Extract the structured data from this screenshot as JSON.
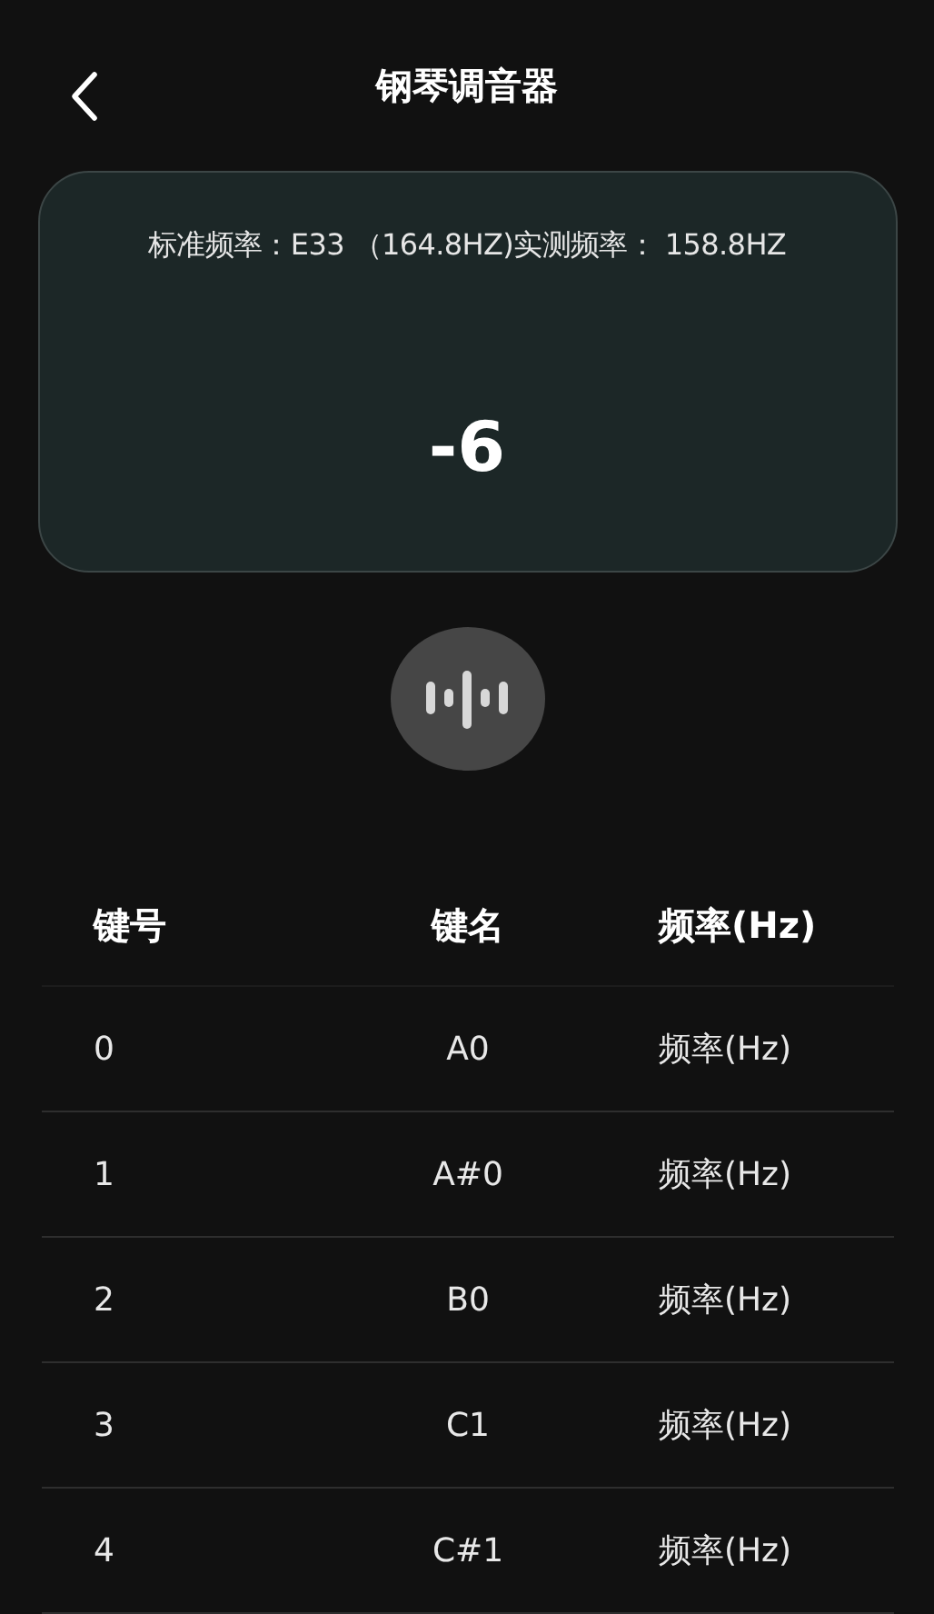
{
  "header": {
    "title": "钢琴调音器"
  },
  "tuner": {
    "info": "标准频率：E33 （164.8HZ)实测频率： 158.8HZ",
    "deviation": "-6"
  },
  "table": {
    "columns": [
      "键号",
      "键名",
      "频率(Hz)"
    ],
    "rows": [
      [
        "0",
        "A0",
        "频率(Hz)"
      ],
      [
        "1",
        "A#0",
        "频率(Hz)"
      ],
      [
        "2",
        "B0",
        "频率(Hz)"
      ],
      [
        "3",
        "C1",
        "频率(Hz)"
      ],
      [
        "4",
        "C#1",
        "频率(Hz)"
      ]
    ]
  }
}
